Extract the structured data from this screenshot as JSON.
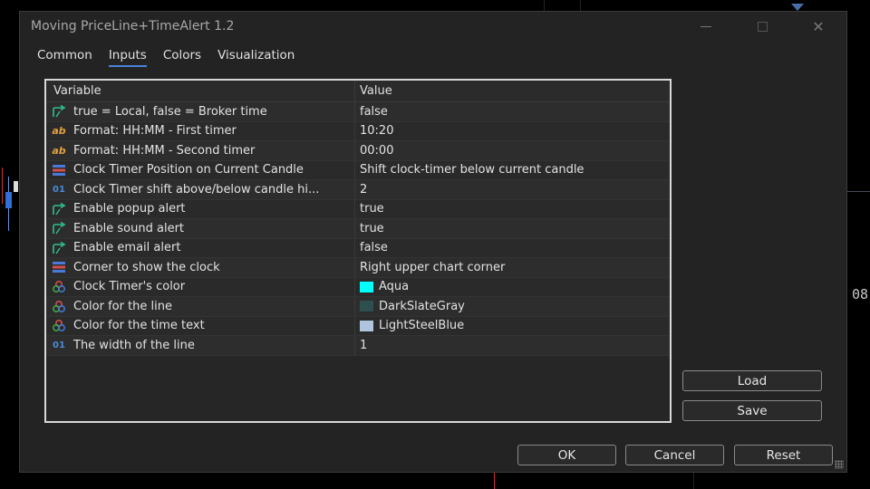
{
  "window": {
    "title": "Moving PriceLine+TimeAlert 1.2"
  },
  "tabs": [
    {
      "label": "Common",
      "active": false
    },
    {
      "label": "Inputs",
      "active": true
    },
    {
      "label": "Colors",
      "active": false
    },
    {
      "label": "Visualization",
      "active": false
    }
  ],
  "grid": {
    "header": {
      "variable": "Variable",
      "value": "Value"
    },
    "rows": [
      {
        "icon": "bool-arrow-icon",
        "variable": "true = Local, false = Broker time",
        "value": "false"
      },
      {
        "icon": "text-ab-icon",
        "variable": "Format: HH:MM - First timer",
        "value": "10:20"
      },
      {
        "icon": "text-ab-icon",
        "variable": "Format: HH:MM - Second timer",
        "value": "00:00"
      },
      {
        "icon": "enum-list-icon",
        "variable": "Clock Timer Position on Current Candle",
        "value": "Shift clock-timer below current candle"
      },
      {
        "icon": "integer-01-icon",
        "variable": "Clock Timer shift above/below candle hi...",
        "value": "2"
      },
      {
        "icon": "bool-arrow-icon",
        "variable": "Enable popup alert",
        "value": "true"
      },
      {
        "icon": "bool-arrow-icon",
        "variable": "Enable sound alert",
        "value": "true"
      },
      {
        "icon": "bool-arrow-icon",
        "variable": "Enable email alert",
        "value": "false"
      },
      {
        "icon": "enum-list-icon",
        "variable": "Corner to show the clock",
        "value": "Right upper chart corner"
      },
      {
        "icon": "color-circles-icon",
        "variable": "Clock Timer's color",
        "value": "Aqua",
        "swatch": "#00ffff"
      },
      {
        "icon": "color-circles-icon",
        "variable": "Color for the line",
        "value": "DarkSlateGray",
        "swatch": "#2f4f4f"
      },
      {
        "icon": "color-circles-icon",
        "variable": "Color for the time text",
        "value": "LightSteelBlue",
        "swatch": "#b0c4de"
      },
      {
        "icon": "integer-01-icon",
        "variable": "The width of the line",
        "value": "1"
      }
    ]
  },
  "side_buttons": {
    "load": "Load",
    "save": "Save"
  },
  "footer_buttons": {
    "ok": "OK",
    "cancel": "Cancel",
    "reset": "Reset"
  },
  "background": {
    "axis_value": "08"
  },
  "colors": {
    "tab_underline": "#4a82d6",
    "bool_icon": "#2fbf8f",
    "text_icon": "#e0a040",
    "int_icon": "#4a8ad8"
  }
}
